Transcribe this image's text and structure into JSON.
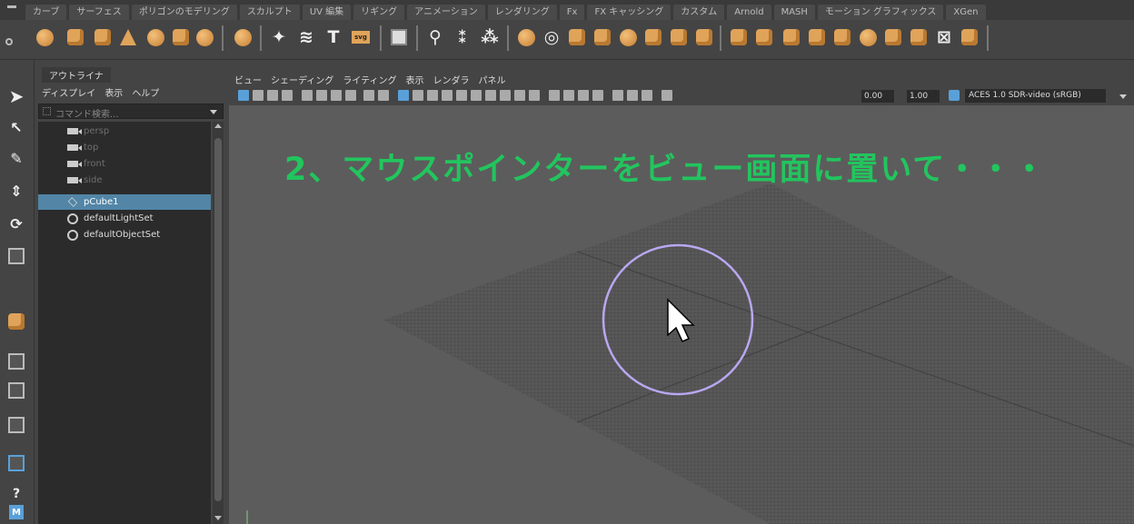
{
  "shelf_tabs": [
    "カーブ",
    "サーフェス",
    "ポリゴンのモデリング",
    "スカルプト",
    "UV 編集",
    "リギング",
    "アニメーション",
    "レンダリング",
    "Fx",
    "FX キャッシング",
    "カスタム",
    "Arnold",
    "MASH",
    "モーション グラフィックス",
    "XGen"
  ],
  "outliner": {
    "title": "アウトライナ",
    "menu": [
      "ディスプレイ",
      "表示",
      "ヘルプ"
    ],
    "search_placeholder": "コマンド検索...",
    "items": [
      {
        "label": "persp",
        "type": "camera"
      },
      {
        "label": "top",
        "type": "camera"
      },
      {
        "label": "front",
        "type": "camera"
      },
      {
        "label": "side",
        "type": "camera"
      },
      {
        "label": "pCube1",
        "type": "mesh",
        "selected": true
      },
      {
        "label": "defaultLightSet",
        "type": "set"
      },
      {
        "label": "defaultObjectSet",
        "type": "set"
      }
    ]
  },
  "viewport": {
    "menu": [
      "ビュー",
      "シェーディング",
      "ライティング",
      "表示",
      "レンダラ",
      "パネル"
    ],
    "exposure": "0.00",
    "gamma": "1.00",
    "color_space": "ACES 1.0 SDR-video (sRGB)",
    "caption": "2、マウスポインターをビュー画面に置いて・・・",
    "highlight_color": "#b9a7f0",
    "caption_color": "#22c55e"
  }
}
